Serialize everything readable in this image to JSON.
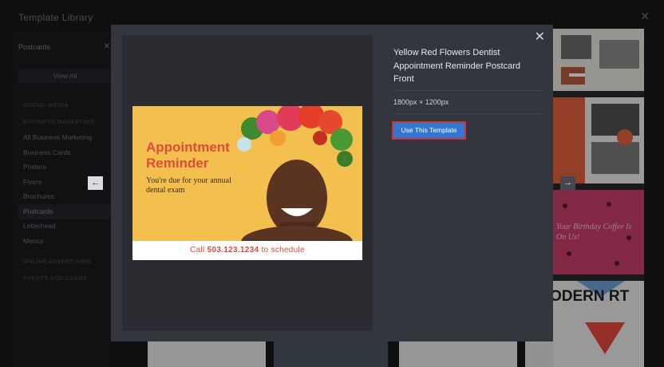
{
  "library": {
    "title": "Template Library",
    "filter_chip": "Postcards",
    "view_all": "View All",
    "headings": [
      "SOCIAL MEDIA",
      "BUSINESS MARKETING",
      "ONLINE ADVERTISING",
      "EVENTS AND CARDS"
    ],
    "items": [
      "All Business Marketing",
      "Business Cards",
      "Posters",
      "Flyers",
      "Brochures",
      "Postcards",
      "Letterhead",
      "Menus"
    ],
    "active_item": "Postcards"
  },
  "thumbnails": {
    "birthday_text": "Your Birthday Coffee Is On Us!",
    "modern_text": "ODERN RT"
  },
  "modal": {
    "title": "Yellow Red Flowers Dentist Appointment Reminder Postcard Front",
    "size": "1800px × 1200px",
    "use_button": "Use This Template"
  },
  "postcard": {
    "headline": "Appointment Reminder",
    "subtext": "You're due for your annual dental exam",
    "cta_prefix": "Call ",
    "phone": "503.123.1234",
    "cta_suffix": " to schedule"
  },
  "colors": {
    "accent_blue": "#3277d6",
    "highlight_red": "#d4322f",
    "postcard_yellow": "#f4c04d",
    "postcard_red": "#e5483c"
  },
  "icons": {
    "modal_close": "close-icon",
    "library_close": "close-icon",
    "prev": "arrow-left-icon",
    "next": "arrow-right-icon"
  }
}
